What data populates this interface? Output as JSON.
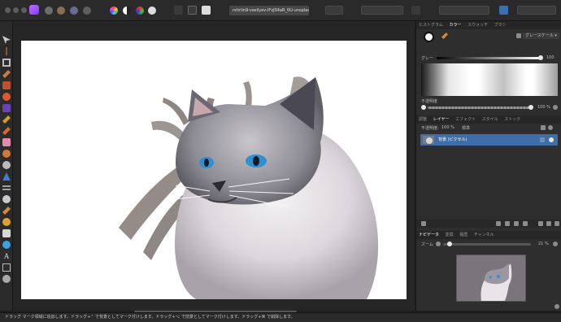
{
  "document_tab": "rstirlin9-vasilyev-lFxJS4aR_0U-unsplas ×",
  "panel_top": {
    "tabs": [
      "ヒストグラム",
      "カラー",
      "スウォッチ",
      "ブラシ"
    ],
    "mode_label": "グレースケール ▾",
    "gray_label": "グレー",
    "gray_value": "100",
    "opacity_label": "不透明度",
    "opacity_value": "100 %"
  },
  "panel_mid": {
    "tabs": [
      "調整",
      "レイヤー",
      "エフェクト",
      "スタイル",
      "ストック"
    ],
    "opacity_label": "不透明度:",
    "opacity_value": "100 %",
    "blend_mode": "標準",
    "layer_name": "背景 (ピクセル)"
  },
  "panel_bottom": {
    "tabs": [
      "ナビゲータ",
      "変換",
      "履歴",
      "チャンネル"
    ],
    "zoom_label": "ズーム",
    "zoom_value": "21 %"
  },
  "status_text": "ドラッグ マーク領域に追加します。ドラッグ+⌃ で背景としてマーク付けします。ドラッグ+⌥ で前景としてマーク付けします。ドラッグ+⌘ で削除します。",
  "colors": {
    "accent": "#3d6ea9",
    "panel": "#2e2e2e",
    "canvas_bg": "#262626"
  },
  "icons": [
    "move-icon",
    "crop-icon",
    "brush-icon",
    "eraser-icon",
    "text-icon",
    "zoom-icon",
    "navigator-thumbnail"
  ]
}
